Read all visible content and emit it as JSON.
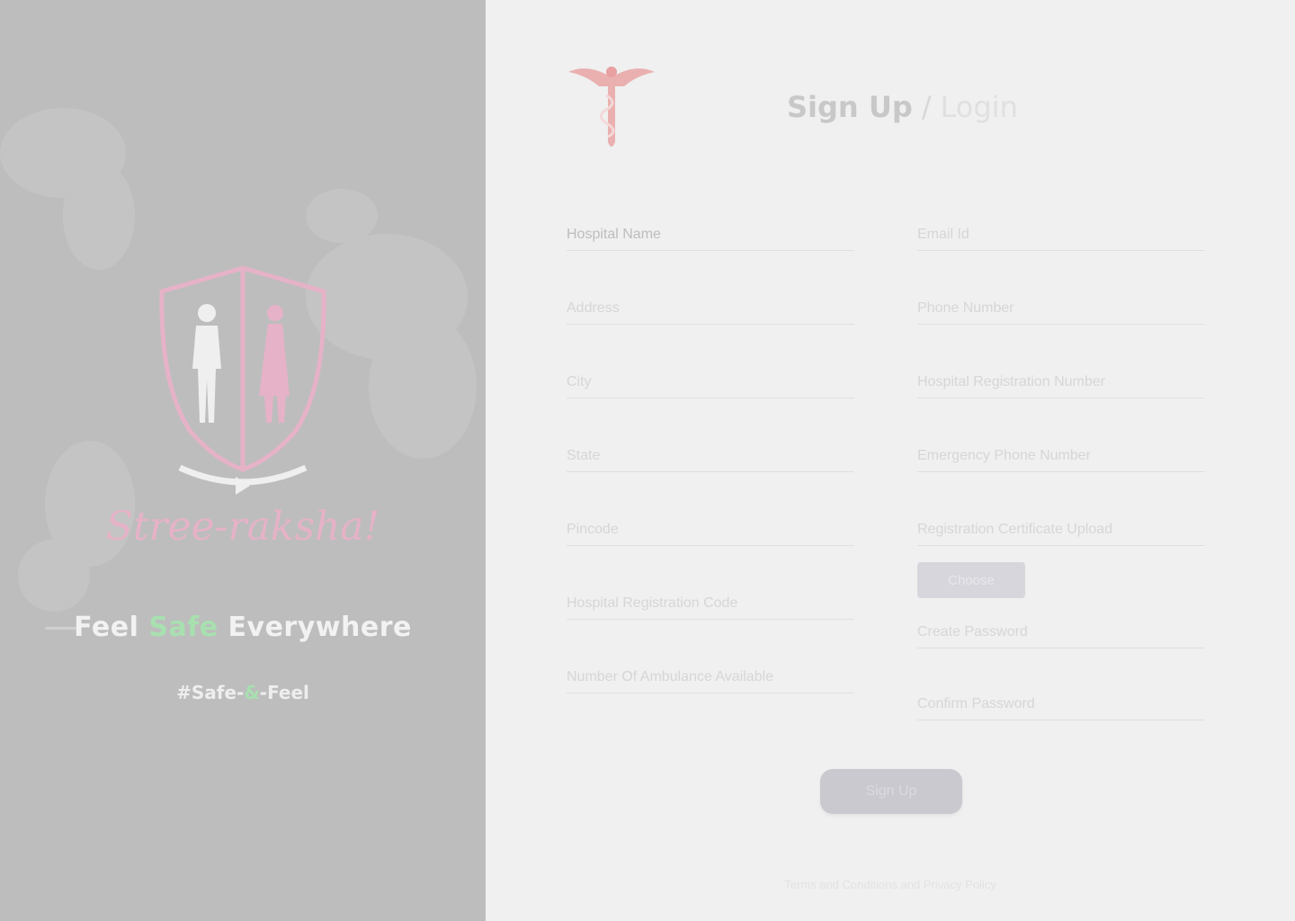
{
  "brand": {
    "script_name": "Stree-raksha!",
    "tagline_prefix": "Feel ",
    "tagline_accent": "Safe",
    "tagline_suffix": " Everywhere",
    "hashtag_prefix": "#Safe-",
    "hashtag_accent": "&",
    "hashtag_suffix": "-Feel"
  },
  "auth": {
    "signup_label": "Sign Up",
    "separator": "/",
    "login_label": "Login"
  },
  "form": {
    "left_fields": [
      {
        "placeholder": "Hospital Name"
      },
      {
        "placeholder": "Address"
      },
      {
        "placeholder": "City"
      },
      {
        "placeholder": "State"
      },
      {
        "placeholder": "Pincode"
      },
      {
        "placeholder": "Hospital Registration Code"
      },
      {
        "placeholder": "Number Of Ambulance Available"
      }
    ],
    "right_fields": [
      {
        "placeholder": "Email Id"
      },
      {
        "placeholder": "Phone Number"
      },
      {
        "placeholder": "Hospital Registration Number"
      },
      {
        "placeholder": "Emergency Phone Number"
      },
      {
        "placeholder": "Registration Certificate Upload"
      },
      {
        "placeholder": "Create Password"
      },
      {
        "placeholder": "Confirm Password"
      }
    ],
    "file_button_label": "Choose",
    "submit_label": "Sign Up"
  },
  "footer": {
    "note": "Terms and Conditions and Privacy Policy"
  },
  "colors": {
    "left_panel_bg": "#bdbdbd",
    "right_panel_bg": "#f0f0f0",
    "accent_green": "#a8e0b0",
    "accent_pink": "#e6b2c7",
    "logo_red": "#e8a0a0"
  }
}
